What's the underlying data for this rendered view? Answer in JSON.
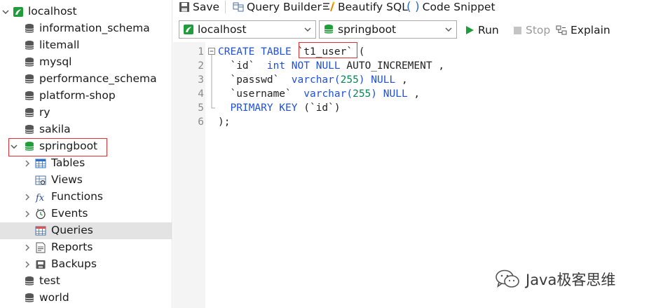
{
  "tree": {
    "connection": "localhost",
    "databases_top": [
      "information_schema",
      "litemall",
      "mysql",
      "performance_schema",
      "platform-shop",
      "ry",
      "sakila"
    ],
    "active_db": "springboot",
    "children": [
      "Tables",
      "Views",
      "Functions",
      "Events",
      "Queries",
      "Reports",
      "Backups"
    ],
    "selected_child": "Queries",
    "databases_bottom": [
      "test",
      "world"
    ]
  },
  "toolbar": {
    "save": "Save",
    "query_builder": "Query Builder",
    "beautify": "Beautify SQL",
    "snippet": "Code Snippet"
  },
  "connection_bar": {
    "connection_value": "localhost",
    "database_value": "springboot",
    "run": "Run",
    "stop": "Stop",
    "explain": "Explain"
  },
  "editor": {
    "line_numbers": [
      "1",
      "2",
      "3",
      "4",
      "5",
      "6"
    ],
    "tokens": {
      "create_table": "CREATE TABLE",
      "table_name": "`t1_user`",
      "paren_open": " (",
      "col_id": "`id`",
      "int": "int",
      "not_null": "NOT NULL",
      "auto_inc": "AUTO_INCREMENT ,",
      "col_passwd": "`passwd`",
      "varchar": "varchar(",
      "n255": "255",
      "paren_close": ")",
      "null": "NULL",
      "comma": " ,",
      "col_username": "`username`",
      "primary_key": "PRIMARY KEY",
      "pk_col": " (`id`)",
      "close": ");"
    }
  },
  "watermark": "Java极客思维",
  "colors": {
    "keyword": "#1f4fdc",
    "number": "#098658",
    "highlight_box": "#e03030",
    "db_icon": "#555555",
    "active_db_icon": "#1f9d3a",
    "selected_row": "#e3e3e3"
  }
}
